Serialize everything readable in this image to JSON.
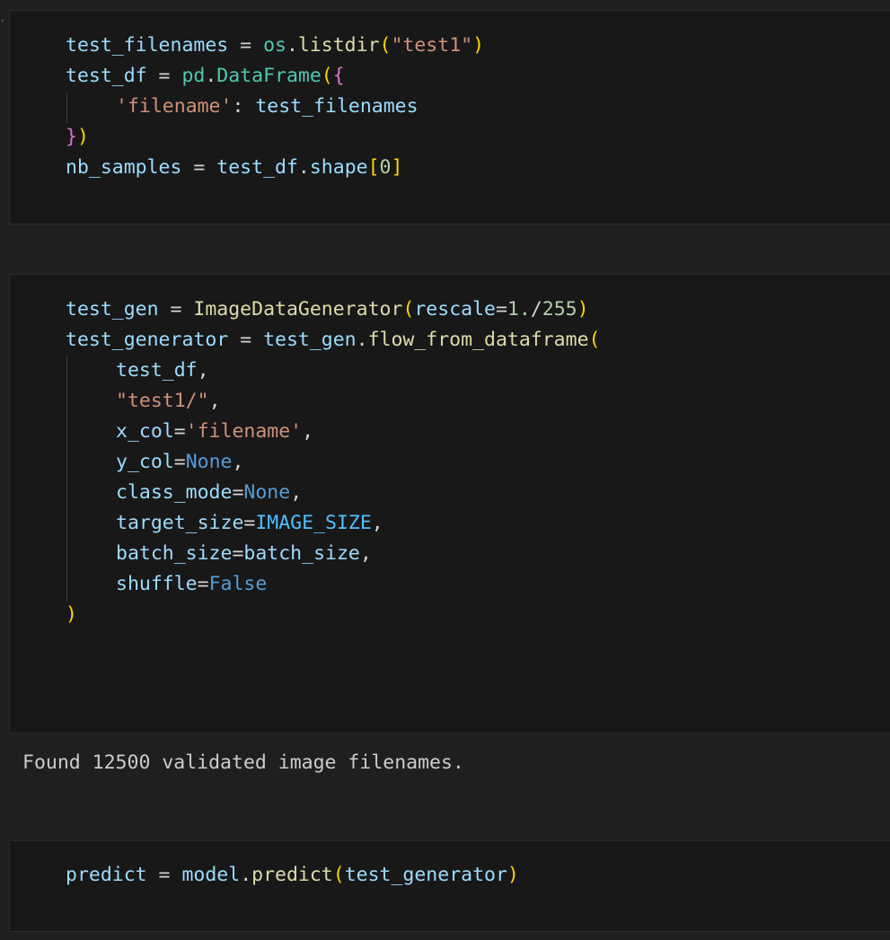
{
  "cells": [
    {
      "lines": [
        {
          "indent": 0,
          "tokens": [
            {
              "t": "test_filenames",
              "c": "var"
            },
            {
              "t": " = ",
              "c": "op"
            },
            {
              "t": "os",
              "c": "mod"
            },
            {
              "t": ".",
              "c": "op"
            },
            {
              "t": "listdir",
              "c": "fn"
            },
            {
              "t": "(",
              "c": "b1"
            },
            {
              "t": "\"test1\"",
              "c": "str"
            },
            {
              "t": ")",
              "c": "b1"
            }
          ]
        },
        {
          "indent": 0,
          "tokens": [
            {
              "t": "test_df",
              "c": "var"
            },
            {
              "t": " = ",
              "c": "op"
            },
            {
              "t": "pd",
              "c": "mod"
            },
            {
              "t": ".",
              "c": "op"
            },
            {
              "t": "DataFrame",
              "c": "mod"
            },
            {
              "t": "(",
              "c": "b1"
            },
            {
              "t": "{",
              "c": "b2"
            }
          ]
        },
        {
          "indent": 1,
          "tokens": [
            {
              "t": "'filename'",
              "c": "str"
            },
            {
              "t": ": ",
              "c": "op"
            },
            {
              "t": "test_filenames",
              "c": "var"
            }
          ]
        },
        {
          "indent": 0,
          "tokens": [
            {
              "t": "}",
              "c": "b2"
            },
            {
              "t": ")",
              "c": "b1"
            }
          ]
        },
        {
          "indent": 0,
          "tokens": [
            {
              "t": "nb_samples",
              "c": "var"
            },
            {
              "t": " = ",
              "c": "op"
            },
            {
              "t": "test_df",
              "c": "var"
            },
            {
              "t": ".",
              "c": "op"
            },
            {
              "t": "shape",
              "c": "var"
            },
            {
              "t": "[",
              "c": "b1"
            },
            {
              "t": "0",
              "c": "num"
            },
            {
              "t": "]",
              "c": "b1"
            }
          ]
        }
      ]
    },
    {
      "lines": [
        {
          "indent": 0,
          "tokens": [
            {
              "t": "test_gen",
              "c": "var"
            },
            {
              "t": " = ",
              "c": "op"
            },
            {
              "t": "ImageDataGenerator",
              "c": "fn"
            },
            {
              "t": "(",
              "c": "b1"
            },
            {
              "t": "rescale",
              "c": "var"
            },
            {
              "t": "=",
              "c": "op"
            },
            {
              "t": "1.",
              "c": "num"
            },
            {
              "t": "/",
              "c": "op"
            },
            {
              "t": "255",
              "c": "num"
            },
            {
              "t": ")",
              "c": "b1"
            }
          ]
        },
        {
          "indent": 0,
          "tokens": [
            {
              "t": "test_generator",
              "c": "var"
            },
            {
              "t": " = ",
              "c": "op"
            },
            {
              "t": "test_gen",
              "c": "var"
            },
            {
              "t": ".",
              "c": "op"
            },
            {
              "t": "flow_from_dataframe",
              "c": "fn"
            },
            {
              "t": "(",
              "c": "b1"
            }
          ]
        },
        {
          "indent": 1,
          "tokens": [
            {
              "t": "test_df",
              "c": "var"
            },
            {
              "t": ",",
              "c": "op"
            }
          ]
        },
        {
          "indent": 1,
          "tokens": [
            {
              "t": "\"test1/\"",
              "c": "str"
            },
            {
              "t": ",",
              "c": "op"
            }
          ]
        },
        {
          "indent": 1,
          "tokens": [
            {
              "t": "x_col",
              "c": "var"
            },
            {
              "t": "=",
              "c": "op"
            },
            {
              "t": "'filename'",
              "c": "str"
            },
            {
              "t": ",",
              "c": "op"
            }
          ]
        },
        {
          "indent": 1,
          "tokens": [
            {
              "t": "y_col",
              "c": "var"
            },
            {
              "t": "=",
              "c": "op"
            },
            {
              "t": "None",
              "c": "kw"
            },
            {
              "t": ",",
              "c": "op"
            }
          ]
        },
        {
          "indent": 1,
          "tokens": [
            {
              "t": "class_mode",
              "c": "var"
            },
            {
              "t": "=",
              "c": "op"
            },
            {
              "t": "None",
              "c": "kw"
            },
            {
              "t": ",",
              "c": "op"
            }
          ]
        },
        {
          "indent": 1,
          "tokens": [
            {
              "t": "target_size",
              "c": "var"
            },
            {
              "t": "=",
              "c": "op"
            },
            {
              "t": "IMAGE_SIZE",
              "c": "const"
            },
            {
              "t": ",",
              "c": "op"
            }
          ]
        },
        {
          "indent": 1,
          "tokens": [
            {
              "t": "batch_size",
              "c": "var"
            },
            {
              "t": "=",
              "c": "op"
            },
            {
              "t": "batch_size",
              "c": "var"
            },
            {
              "t": ",",
              "c": "op"
            }
          ]
        },
        {
          "indent": 1,
          "tokens": [
            {
              "t": "shuffle",
              "c": "var"
            },
            {
              "t": "=",
              "c": "op"
            },
            {
              "t": "False",
              "c": "kw"
            }
          ]
        },
        {
          "indent": 0,
          "tokens": [
            {
              "t": ")",
              "c": "b1"
            }
          ]
        }
      ]
    },
    {
      "lines": [
        {
          "indent": 0,
          "tokens": [
            {
              "t": "predict",
              "c": "var"
            },
            {
              "t": " = ",
              "c": "op"
            },
            {
              "t": "model",
              "c": "var"
            },
            {
              "t": ".",
              "c": "op"
            },
            {
              "t": "predict",
              "c": "fn"
            },
            {
              "t": "(",
              "c": "b1"
            },
            {
              "t": "test_generator",
              "c": "var"
            },
            {
              "t": ")",
              "c": "b1"
            }
          ]
        }
      ]
    }
  ],
  "output": {
    "text": "Found 12500 validated image filenames."
  },
  "colors": {
    "background": "#1f1f1f",
    "cell_background": "#181818",
    "variable": "#9cdcfe",
    "function": "#dcdcaa",
    "module": "#4ec9b0",
    "string": "#ce9178",
    "number": "#b5cea8",
    "keyword": "#569cd6",
    "constant": "#4fc1ff",
    "bracket_level1": "#ffd700",
    "bracket_level2": "#da70d6"
  }
}
